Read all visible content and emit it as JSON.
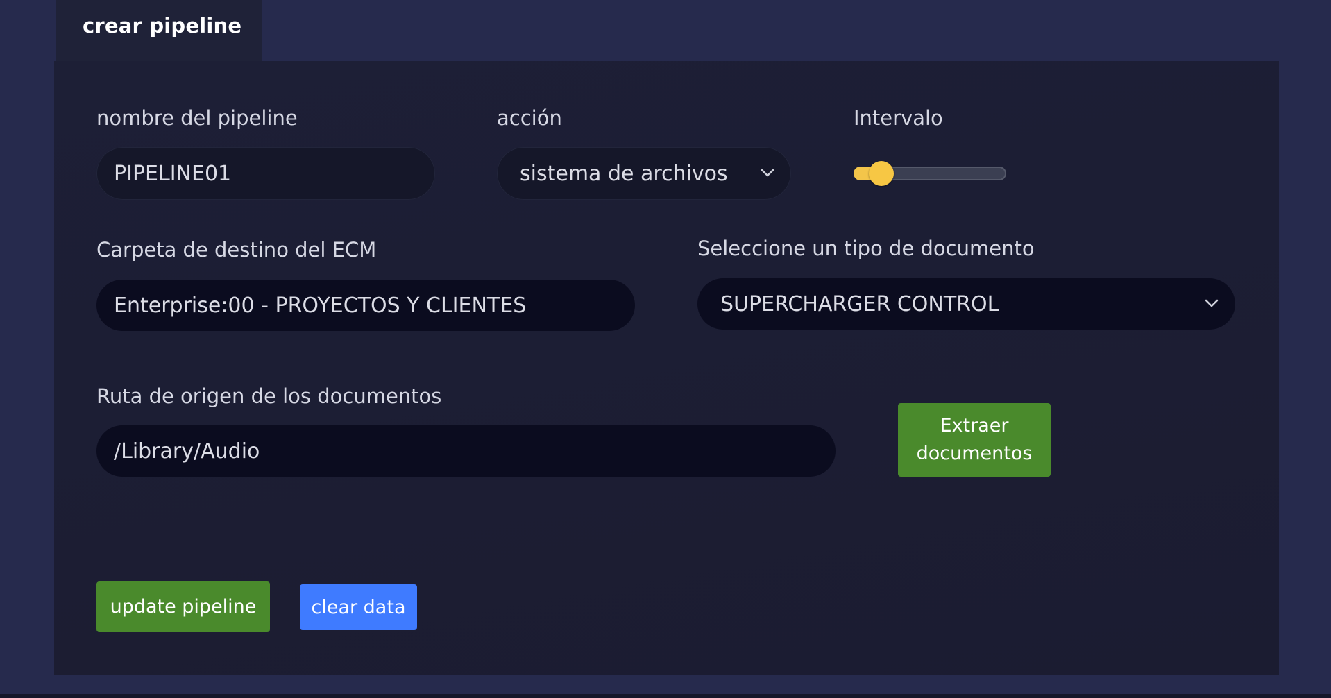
{
  "tab": {
    "label": "crear pipeline"
  },
  "form": {
    "pipeline_name": {
      "label": "nombre del pipeline",
      "value": "PIPELINE01"
    },
    "action": {
      "label": "acción",
      "value": "sistema de archivos"
    },
    "interval": {
      "label": "Intervalo",
      "level_percent": 18
    },
    "destination_folder": {
      "label": "Carpeta de destino del ECM",
      "value": "Enterprise:00 - PROYECTOS Y CLIENTES"
    },
    "document_type": {
      "label": "Seleccione un tipo de documento",
      "value": "SUPERCHARGER CONTROL"
    },
    "source_path": {
      "label": "Ruta de origen de los documentos",
      "value": "/Library/Audio"
    },
    "extract_button": "Extraer documentos"
  },
  "actions": {
    "update_label": "update pipeline",
    "clear_label": "clear data"
  },
  "colors": {
    "background": "#262a4d",
    "panel": "#1d1f36",
    "green_button": "#4a8a2c",
    "blue_button": "#3f7bff",
    "slider_accent": "#f7c744"
  },
  "icons": {
    "select_arrow": "chevron-down-icon"
  }
}
